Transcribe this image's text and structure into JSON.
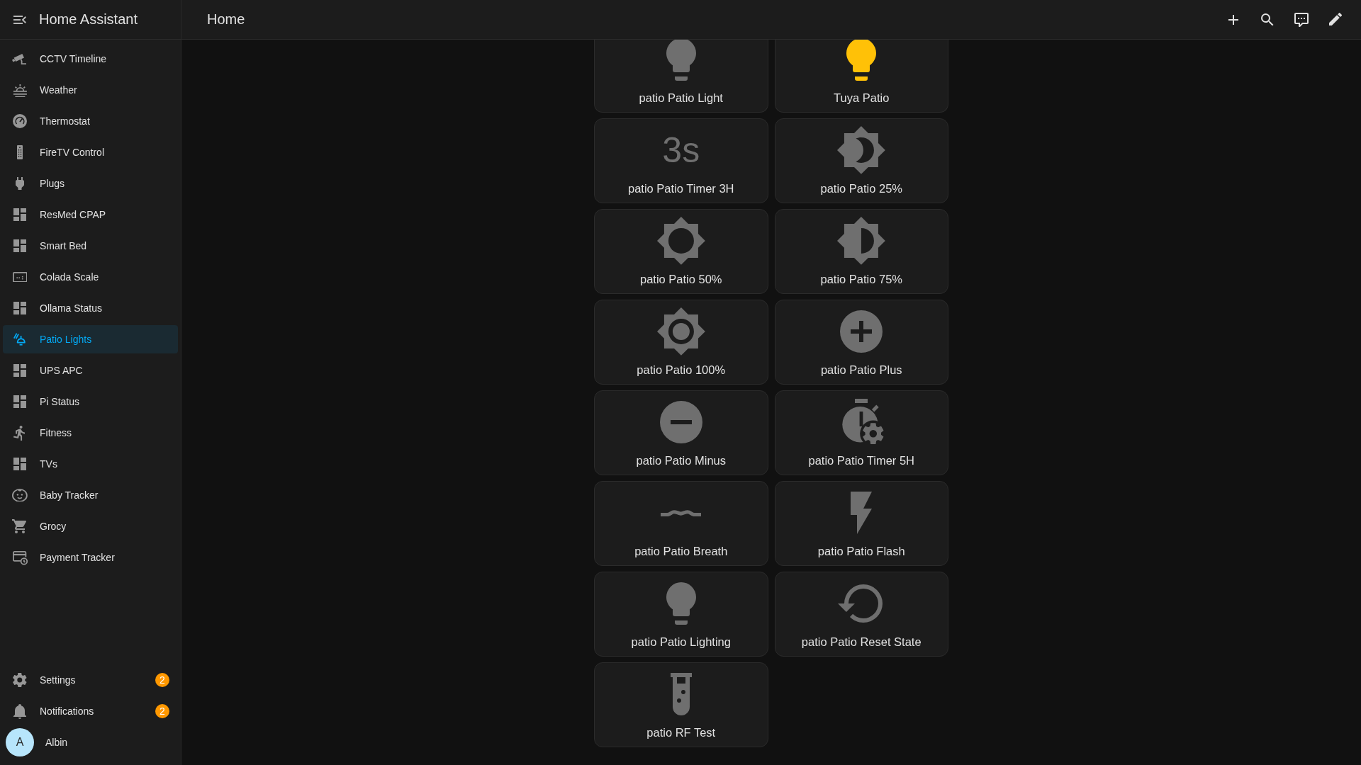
{
  "sidebar": {
    "title": "Home Assistant",
    "items": [
      {
        "label": "CCTV Timeline",
        "kind": "camera",
        "selected": false
      },
      {
        "label": "Weather",
        "kind": "sunset",
        "selected": false
      },
      {
        "label": "Thermostat",
        "kind": "gauge",
        "selected": false
      },
      {
        "label": "FireTV Control",
        "kind": "remote",
        "selected": false
      },
      {
        "label": "Plugs",
        "kind": "plug",
        "selected": false
      },
      {
        "label": "ResMed CPAP",
        "kind": "dashboard",
        "selected": false
      },
      {
        "label": "Smart Bed",
        "kind": "dashboard",
        "selected": false
      },
      {
        "label": "Colada Scale",
        "kind": "scale",
        "selected": false
      },
      {
        "label": "Ollama Status",
        "kind": "dashboard",
        "selected": false
      },
      {
        "label": "Patio Lights",
        "kind": "lamps",
        "selected": true
      },
      {
        "label": "UPS APC",
        "kind": "dashboard",
        "selected": false
      },
      {
        "label": "Pi Status",
        "kind": "dashboard",
        "selected": false
      },
      {
        "label": "Fitness",
        "kind": "runner",
        "selected": false
      },
      {
        "label": "TVs",
        "kind": "dashboard",
        "selected": false
      },
      {
        "label": "Baby Tracker",
        "kind": "baby",
        "selected": false
      },
      {
        "label": "Grocy",
        "kind": "cart",
        "selected": false
      },
      {
        "label": "Payment Tracker",
        "kind": "cardclock",
        "selected": false
      }
    ],
    "footer_items": [
      {
        "label": "Settings",
        "kind": "cog",
        "badge": "2",
        "selected": false
      },
      {
        "label": "Notifications",
        "kind": "bell",
        "badge": "2",
        "selected": false
      }
    ],
    "user": {
      "initial": "A",
      "name": "Albin"
    }
  },
  "header": {
    "title": "Home"
  },
  "tiles": [
    {
      "label": "patio Patio Light",
      "kind": "bulb",
      "on": false
    },
    {
      "label": "Tuya Patio",
      "kind": "bulb",
      "on": true
    },
    {
      "label": "patio Patio Timer 3H",
      "kind": "glyph",
      "glyph": "3s",
      "on": false
    },
    {
      "label": "patio Patio 25%",
      "kind": "crescent",
      "on": false
    },
    {
      "label": "patio Patio 50%",
      "kind": "ring",
      "on": false
    },
    {
      "label": "patio Patio 75%",
      "kind": "halfsun",
      "on": false
    },
    {
      "label": "patio Patio 100%",
      "kind": "fullsun",
      "on": false
    },
    {
      "label": "patio Patio Plus",
      "kind": "plus",
      "on": false
    },
    {
      "label": "patio Patio Minus",
      "kind": "minus",
      "on": false
    },
    {
      "label": "patio Patio Timer 5H",
      "kind": "stopwatch",
      "on": false
    },
    {
      "label": "patio Patio Breath",
      "kind": "wave",
      "on": false
    },
    {
      "label": "patio Patio Flash",
      "kind": "flash",
      "on": false
    },
    {
      "label": "patio Patio Lighting",
      "kind": "bulb",
      "on": false
    },
    {
      "label": "patio Patio Reset State",
      "kind": "restore",
      "on": false
    },
    {
      "label": "patio RF Test",
      "kind": "tube",
      "on": false
    }
  ]
}
